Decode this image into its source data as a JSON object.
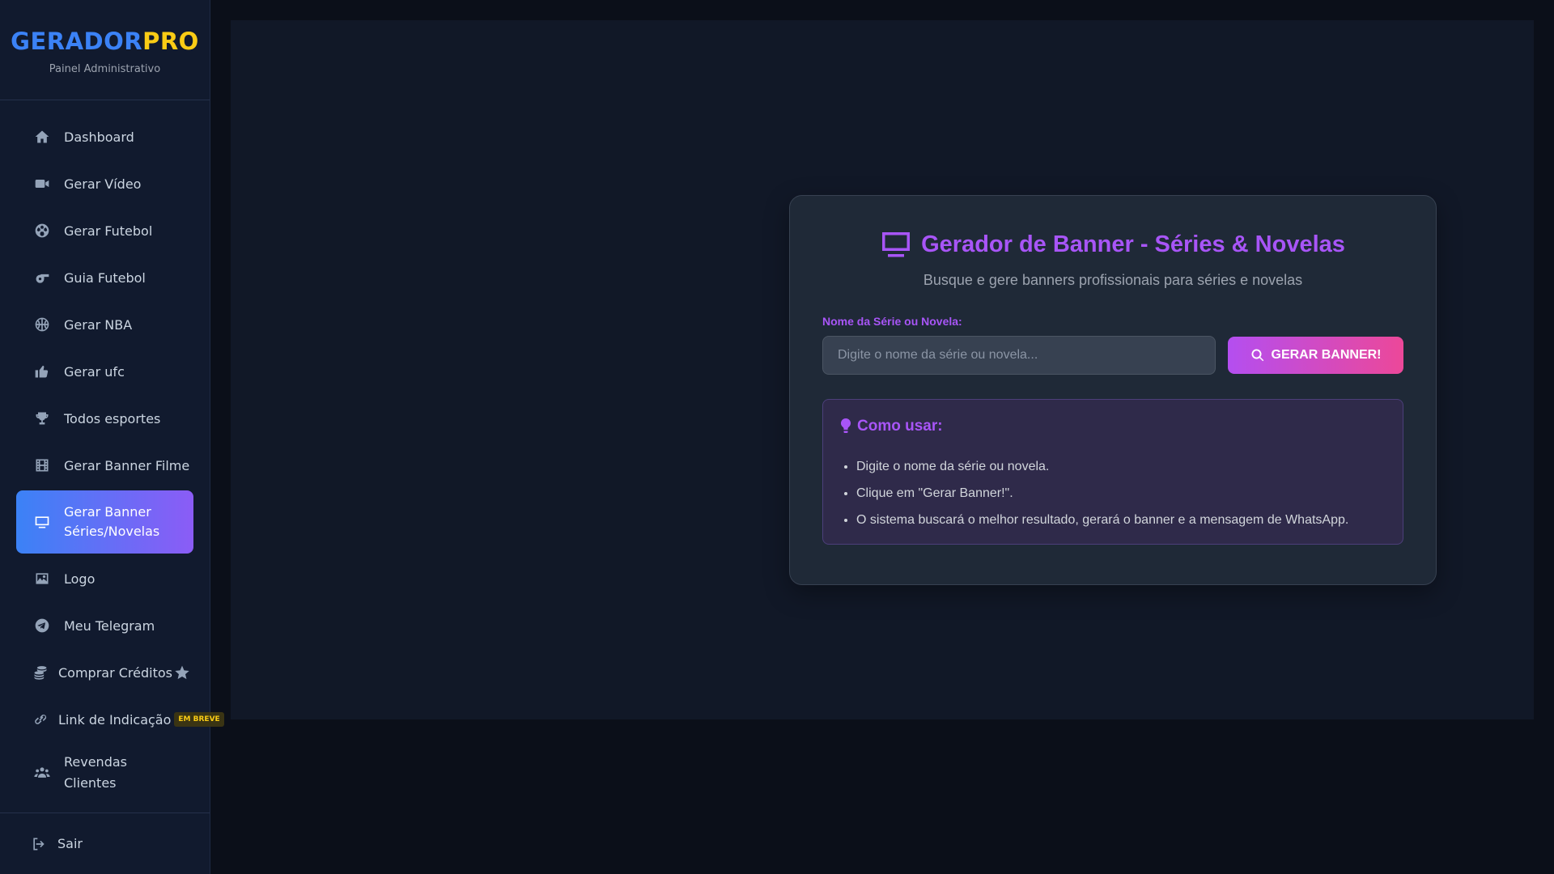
{
  "brand": {
    "name_part1": "GERADOR",
    "name_part2": "PRO",
    "subtitle": "Painel Administrativo",
    "colors": {
      "part1": "#3b82f6",
      "part2": "#facc15"
    }
  },
  "sidebar": {
    "items": [
      {
        "label": "Dashboard",
        "icon": "home-icon"
      },
      {
        "label": "Gerar Vídeo",
        "icon": "video-camera-icon"
      },
      {
        "label": "Gerar Futebol",
        "icon": "soccer-ball-icon"
      },
      {
        "label": "Guia Futebol",
        "icon": "whistle-icon"
      },
      {
        "label": "Gerar NBA",
        "icon": "basketball-icon"
      },
      {
        "label": "Gerar ufc",
        "icon": "thumbs-up-icon"
      },
      {
        "label": "Todos esportes",
        "icon": "trophy-icon"
      },
      {
        "label": "Gerar Banner Filme",
        "icon": "film-icon"
      },
      {
        "label": "Gerar Banner Séries/Novelas",
        "icon": "tv-icon",
        "active": true
      },
      {
        "label": "Logo",
        "icon": "image-icon"
      },
      {
        "label": "Meu Telegram",
        "icon": "telegram-icon"
      },
      {
        "label": "Comprar Créditos",
        "icon": "coins-icon",
        "trail_icon": "star-icon"
      },
      {
        "label": "Link de Indicação",
        "icon": "link-icon",
        "badge": "EM BREVE"
      },
      {
        "label": "Revendas Clientes",
        "icon": "users-icon"
      }
    ],
    "logout_label": "Sair",
    "active_gradient": [
      "#3b82f6",
      "#8b5cf6"
    ]
  },
  "main": {
    "title": "Gerador de Banner - Séries & Novelas",
    "subtitle": "Busque e gere banners profissionais para séries e novelas",
    "field_label": "Nome da Série ou Novela:",
    "search_placeholder": "Digite o nome da série ou novela...",
    "search_value": "",
    "button_label": "GERAR BANNER!",
    "howto": {
      "title": "Como usar:",
      "steps": [
        "Digite o nome da série ou novela.",
        "Clique em \"Gerar Banner!\".",
        "O sistema buscará o melhor resultado, gerará o banner e a mensagem de WhatsApp."
      ]
    },
    "accent_color": "#a855f7"
  }
}
